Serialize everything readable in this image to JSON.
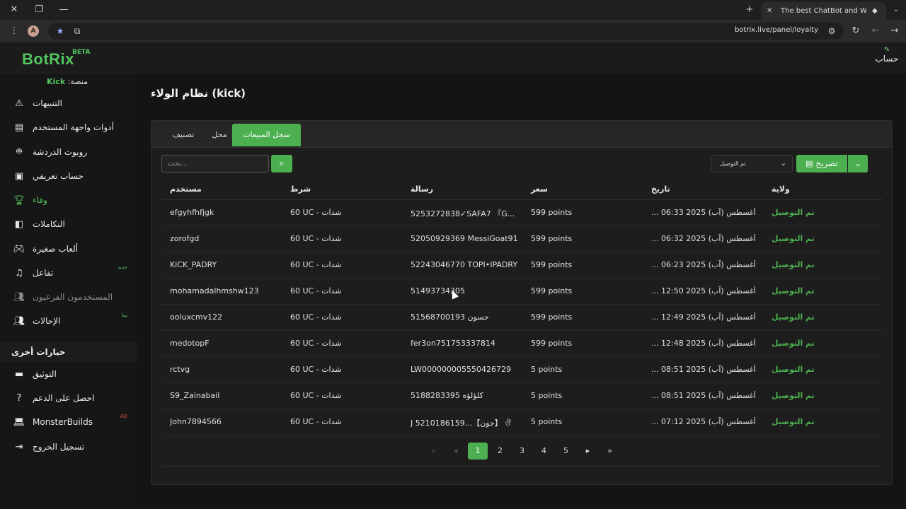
{
  "browser": {
    "tab_title": "The best ChatBot and Widgets",
    "url": "botrix.live/panel/loyalty",
    "profile_initial": "A"
  },
  "app": {
    "logo": "BotRix",
    "beta": "BETA",
    "account_label": "حساب",
    "account_sub": "ي"
  },
  "sidebar": {
    "platform_label": "منصة:",
    "platform_value": "Kick",
    "items": [
      {
        "label": "التنبيهات",
        "icon": "warning-icon"
      },
      {
        "label": "أدوات واجهة المستخدم",
        "icon": "widgets-icon"
      },
      {
        "label": "روبوت الدردشة",
        "icon": "robot-icon"
      },
      {
        "label": "حساب تعريفي",
        "icon": "id-card-icon"
      },
      {
        "label": "وفاء",
        "icon": "trophy-icon"
      },
      {
        "label": "التكاملات",
        "icon": "integration-icon"
      },
      {
        "label": "ألعاب صغيرة",
        "icon": "gamepad-icon"
      },
      {
        "label": "تفاعل",
        "icon": "music-icon",
        "badge": "جديد"
      },
      {
        "label": "المستخدمون الفرعيون",
        "icon": "users-icon"
      },
      {
        "label": "الإحالات",
        "icon": "referral-icon",
        "badge": "بيتا"
      }
    ],
    "section_header": "خيارات أخرى",
    "other_items": [
      {
        "label": "التوثيق",
        "icon": "book-icon"
      },
      {
        "label": "احصل على الدعم",
        "icon": "help-icon"
      },
      {
        "label": "MonsterBuilds",
        "icon": "laptop-icon",
        "badge": "AD"
      },
      {
        "label": "تسجيل الخروج",
        "icon": "logout-icon"
      }
    ]
  },
  "main": {
    "title": "نظام الولاء (kick)",
    "tabs": [
      "سجل المبيعات",
      "محل",
      "تصنيف"
    ],
    "search_placeholder": "بحث...",
    "filter_value": "تم التوصيل",
    "export_label": "تصريح",
    "columns": [
      "مستخدم",
      "شرط",
      "رسالة",
      "سعر",
      "تاريخ",
      "ولاية"
    ],
    "rows": [
      {
        "user": "efgyhfhfjgk",
        "cond": "60 UC - شدات",
        "msg": "5253272838✓SAFA7 『G...",
        "price": "599 points",
        "date": "... أغسطس (آب) 2025 06:33",
        "status": "تم التوصيل"
      },
      {
        "user": "zorofgd",
        "cond": "60 UC - شدات",
        "msg": "52050929369 MessiGoat91",
        "price": "599 points",
        "date": "... أغسطس (آب) 2025 06:32",
        "status": "تم التوصيل"
      },
      {
        "user": "KiCK_PADRY",
        "cond": "60 UC - شدات",
        "msg": "52243046770 TOPI•IPADRY",
        "price": "599 points",
        "date": "... أغسطس (آب) 2025 06:23",
        "status": "تم التوصيل"
      },
      {
        "user": "mohamadalhmshw123",
        "cond": "60 UC - شدات",
        "msg": "51493734305",
        "price": "599 points",
        "date": "... أغسطس (آب) 2025 12:50",
        "status": "تم التوصيل"
      },
      {
        "user": "ooluxcmv122",
        "cond": "60 UC - شدات",
        "msg": "51568700193 حسون",
        "price": "599 points",
        "date": "... أغسطس (آب) 2025 12:49",
        "status": "تم التوصيل"
      },
      {
        "user": "medotopF",
        "cond": "60 UC - شدات",
        "msg": "fer3on751753337814",
        "price": "599 points",
        "date": "... أغسطس (آب) 2025 12:48",
        "status": "تم التوصيل"
      },
      {
        "user": "rctvg",
        "cond": "60 UC - شدات",
        "msg": "LW000000005550426729",
        "price": "5 points",
        "date": "... أغسطس (آب) 2025 08:51",
        "status": "تم التوصيل"
      },
      {
        "user": "S9_Zainabail",
        "cond": "60 UC - شدات",
        "msg": "5188283395 كلؤلؤه",
        "price": "5 points",
        "date": "... أغسطس (آب) 2025 08:51",
        "status": "تم التوصيل"
      },
      {
        "user": "John7894566",
        "cond": "60 UC - شدات",
        "msg": "J 5210186159...【جون】 ঔ",
        "price": "5 points",
        "date": "... أغسطس (آب) 2025 07:12",
        "status": "تم التوصيل"
      }
    ],
    "pages": [
      "1",
      "2",
      "3",
      "4",
      "5"
    ]
  }
}
